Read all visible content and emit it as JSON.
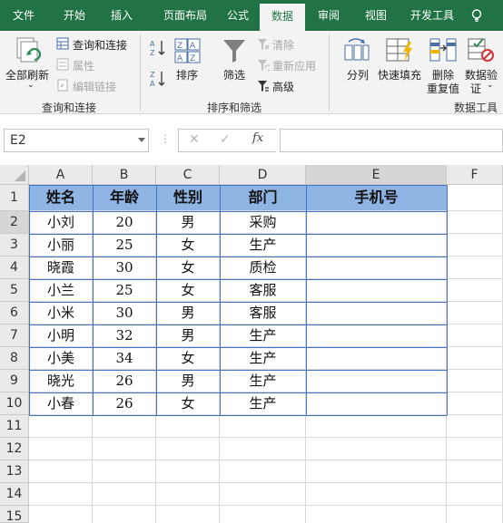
{
  "menu": {
    "tabs": [
      "文件",
      "开始",
      "插入",
      "页面布局",
      "公式",
      "数据",
      "审阅",
      "视图",
      "开发工具"
    ],
    "active_tab": "数据"
  },
  "ribbon": {
    "group1": {
      "label": "查询和连接",
      "refresh_all": "全部刷新",
      "queries_connections": "查询和连接",
      "properties": "属性",
      "edit_links": "编辑链接"
    },
    "group2": {
      "label": "排序和筛选",
      "sort": "排序",
      "filter": "筛选",
      "clear": "清除",
      "reapply": "重新应用",
      "advanced": "高级"
    },
    "group3": {
      "label": "数据工具",
      "text_to_columns": "分列",
      "flash_fill": "快速填充",
      "remove_duplicates_1": "删除",
      "remove_duplicates_2": "重复值",
      "data_validation_1": "数据验",
      "data_validation_2": "证"
    }
  },
  "formula_bar": {
    "name_box": "E2",
    "fx": "fx",
    "formula": ""
  },
  "grid": {
    "columns": [
      "A",
      "B",
      "C",
      "D",
      "E",
      "F"
    ],
    "rows": [
      "1",
      "2",
      "3",
      "4",
      "5",
      "6",
      "7",
      "8",
      "9",
      "10",
      "11",
      "12",
      "13",
      "14",
      "15"
    ],
    "header": [
      "姓名",
      "年龄",
      "性别",
      "部门",
      "手机号"
    ],
    "data": [
      [
        "小刘",
        "20",
        "男",
        "采购",
        ""
      ],
      [
        "小丽",
        "25",
        "女",
        "生产",
        ""
      ],
      [
        "晓霞",
        "30",
        "女",
        "质检",
        ""
      ],
      [
        "小兰",
        "25",
        "女",
        "客服",
        ""
      ],
      [
        "小米",
        "30",
        "男",
        "客服",
        ""
      ],
      [
        "小明",
        "32",
        "男",
        "生产",
        ""
      ],
      [
        "小美",
        "34",
        "女",
        "生产",
        ""
      ],
      [
        "晓光",
        "26",
        "男",
        "生产",
        ""
      ],
      [
        "小春",
        "26",
        "女",
        "生产",
        ""
      ]
    ],
    "header_fill": "#8db4e2"
  },
  "colors": {
    "menu_bg": "#217346",
    "ribbon_bg": "#f3f3f3",
    "grid_border": "#4472c4"
  }
}
